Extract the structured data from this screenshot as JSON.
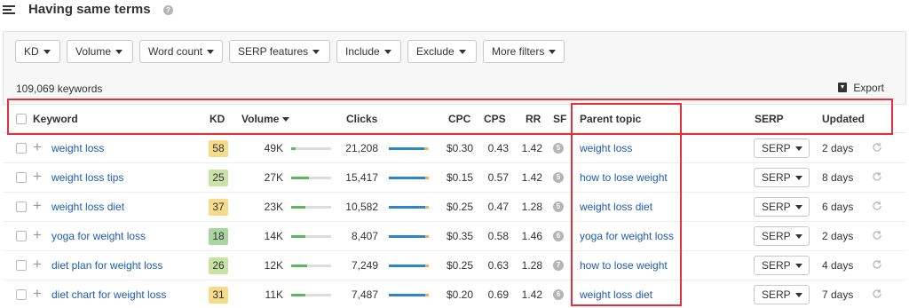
{
  "header": {
    "title": "Having same terms",
    "help": "?"
  },
  "filters": [
    {
      "label": "KD"
    },
    {
      "label": "Volume"
    },
    {
      "label": "Word count"
    },
    {
      "label": "SERP features"
    },
    {
      "label": "Include"
    },
    {
      "label": "Exclude"
    },
    {
      "label": "More filters"
    }
  ],
  "summary": {
    "count": "109,069 keywords",
    "export_label": "Export"
  },
  "table": {
    "columns": {
      "keyword": "Keyword",
      "kd": "KD",
      "volume": "Volume",
      "clicks": "Clicks",
      "cpc": "CPC",
      "cps": "CPS",
      "rr": "RR",
      "sf": "SF",
      "parent_topic": "Parent topic",
      "serp": "SERP",
      "updated": "Updated"
    },
    "rows": [
      {
        "keyword": "weight loss",
        "kd": "58",
        "kd_color": "#f5dc8a",
        "volume": "49K",
        "volume_level": 0.1,
        "clicks": "21,208",
        "clicks_level": 0.88,
        "cpc": "$0.30",
        "cps": "0.43",
        "rr": "1.42",
        "sf": "5",
        "parent_topic": "weight loss",
        "serp": "SERP",
        "updated": "2 days"
      },
      {
        "keyword": "weight loss tips",
        "kd": "25",
        "kd_color": "#c9e3a6",
        "volume": "27K",
        "volume_level": 0.45,
        "clicks": "15,417",
        "clicks_level": 0.9,
        "cpc": "$0.15",
        "cps": "0.57",
        "rr": "1.42",
        "sf": "5",
        "parent_topic": "how to lose weight",
        "serp": "SERP",
        "updated": "8 days"
      },
      {
        "keyword": "weight loss diet",
        "kd": "37",
        "kd_color": "#f5dc8a",
        "volume": "23K",
        "volume_level": 0.35,
        "clicks": "10,582",
        "clicks_level": 0.9,
        "cpc": "$0.25",
        "cps": "0.47",
        "rr": "1.28",
        "sf": "5",
        "parent_topic": "weight loss diet",
        "serp": "SERP",
        "updated": "6 days"
      },
      {
        "keyword": "yoga for weight loss",
        "kd": "18",
        "kd_color": "#a9d6a0",
        "volume": "14K",
        "volume_level": 0.35,
        "clicks": "8,407",
        "clicks_level": 0.9,
        "cpc": "$0.35",
        "cps": "0.58",
        "rr": "1.46",
        "sf": "6",
        "parent_topic": "yoga for weight loss",
        "serp": "SERP",
        "updated": "2 days"
      },
      {
        "keyword": "diet plan for weight loss",
        "kd": "26",
        "kd_color": "#c9e3a6",
        "volume": "12K",
        "volume_level": 0.4,
        "clicks": "7,249",
        "clicks_level": 0.9,
        "cpc": "$0.25",
        "cps": "0.63",
        "rr": "1.28",
        "sf": "7",
        "parent_topic": "how to lose weight",
        "serp": "SERP",
        "updated": "4 days"
      },
      {
        "keyword": "diet chart for weight loss",
        "kd": "31",
        "kd_color": "#f5dc8a",
        "volume": "11K",
        "volume_level": 0.35,
        "clicks": "7,487",
        "clicks_level": 0.9,
        "cpc": "$0.20",
        "cps": "0.69",
        "rr": "1.42",
        "sf": "6",
        "parent_topic": "weight loss diet",
        "serp": "SERP",
        "updated": "7 days"
      }
    ]
  },
  "colors": {
    "link": "#1f5bb3",
    "annotation": "#e5303a",
    "volume_bar": "#5cb85c",
    "clicks_bar": "#2d86c8"
  }
}
